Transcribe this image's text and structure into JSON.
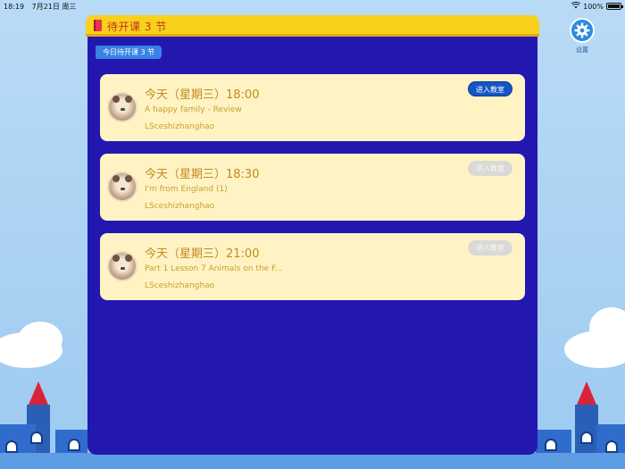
{
  "status_bar": {
    "time": "18:19",
    "date": "7月21日 周三",
    "battery": "100%",
    "battery_level": 1.0
  },
  "header": {
    "title": "待开课 3 节"
  },
  "tag": {
    "label": "今日待开课 3 节"
  },
  "settings": {
    "label": "设置",
    "icon": "gear-icon"
  },
  "courses": [
    {
      "time": "今天（星期三）18:00",
      "lesson": "A happy family - Review",
      "teacher": "LSceshizhanghao",
      "button": "进入教室",
      "enabled": true
    },
    {
      "time": "今天（星期三）18:30",
      "lesson": "I'm from England (1)",
      "teacher": "LSceshizhanghao",
      "button": "进入教室",
      "enabled": false
    },
    {
      "time": "今天（星期三）21:00",
      "lesson": "Part 1 Lesson 7 Animals on the F...",
      "teacher": "LSceshizhanghao",
      "button": "进入教室",
      "enabled": false
    }
  ],
  "colors": {
    "panel": "#2218b0",
    "header": "#f7d11c",
    "card": "#fff3c4",
    "active_button": "#1556c4"
  }
}
